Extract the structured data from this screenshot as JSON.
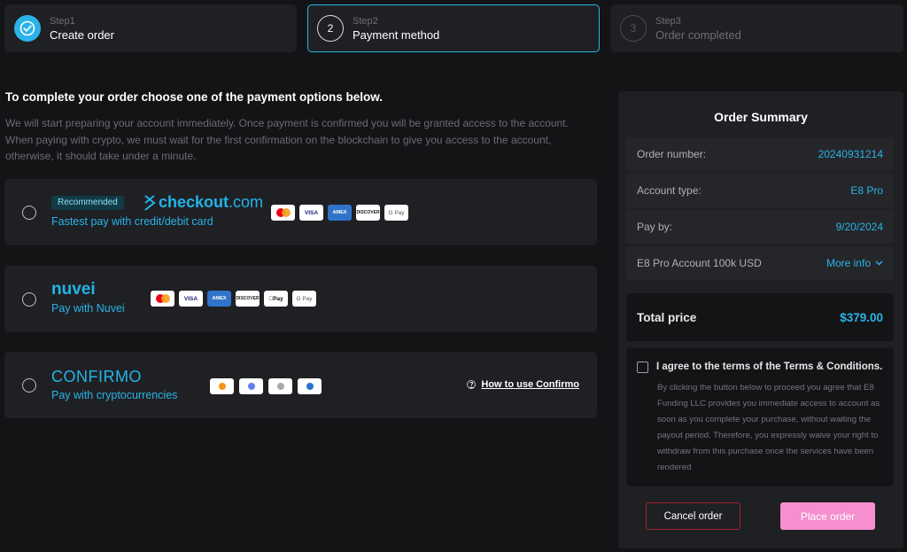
{
  "steps": [
    {
      "small": "Step1",
      "label": "Create order",
      "state": "done"
    },
    {
      "small": "Step2",
      "label": "Payment method",
      "num": "2",
      "state": "current"
    },
    {
      "small": "Step3",
      "label": "Order completed",
      "num": "3",
      "state": "todo"
    }
  ],
  "main": {
    "heading": "To complete your order choose one of the payment options below.",
    "description": "We will start preparing your account immediately. Once payment is confirmed you will be granted access to the account. When paying with crypto, we must wait for the first confirmation on the blockchain to give you access to the account, otherwise, it should take under a minute."
  },
  "options": [
    {
      "badge": "Recommended",
      "brand_a": "checkout",
      "brand_b": ".com",
      "subtitle": "Fastest pay with credit/debit card",
      "cards": [
        "mastercard",
        "VISA",
        "AMEX",
        "DISCOVER",
        "G Pay"
      ]
    },
    {
      "brand": "nuvei",
      "subtitle": "Pay with Nuvei",
      "cards": [
        "mastercard",
        "VISA",
        "AMEX",
        "DISCOVER",
        "Pay",
        "G Pay"
      ]
    },
    {
      "brand": "CONFIRMO",
      "subtitle": "Pay with cryptocurrencies",
      "coins": [
        "bitcoin-icon",
        "ethereum-icon",
        "litecoin-icon",
        "usdc-icon"
      ],
      "howto": "How to use Confirmo"
    }
  ],
  "summary": {
    "title": "Order Summary",
    "rows": [
      {
        "key": "Order number:",
        "value": "20240931214"
      },
      {
        "key": "Account type:",
        "value": "E8 Pro"
      },
      {
        "key": "Pay by:",
        "value": "9/20/2024"
      },
      {
        "key": "E8 Pro Account 100k USD",
        "value": "More info"
      }
    ],
    "total_label": "Total price",
    "total_value": "$379.00",
    "agree_text": "I agree to the terms of the Terms & Conditions.",
    "terms_text": "By clicking the button below to proceed you agree that E8 Funding LLC provides you immediate access to account as soon as you complete your purchase, without waiting the payout period. Therefore, you expressly waive your right to withdraw from this purchase once the services have been rendered",
    "cancel_label": "Cancel order",
    "place_label": "Place order"
  },
  "colors": {
    "accent": "#2ab3e8",
    "background": "#131416",
    "panel": "#1f2023",
    "place_button": "#f58fcf",
    "cancel_border": "#a3222f"
  }
}
